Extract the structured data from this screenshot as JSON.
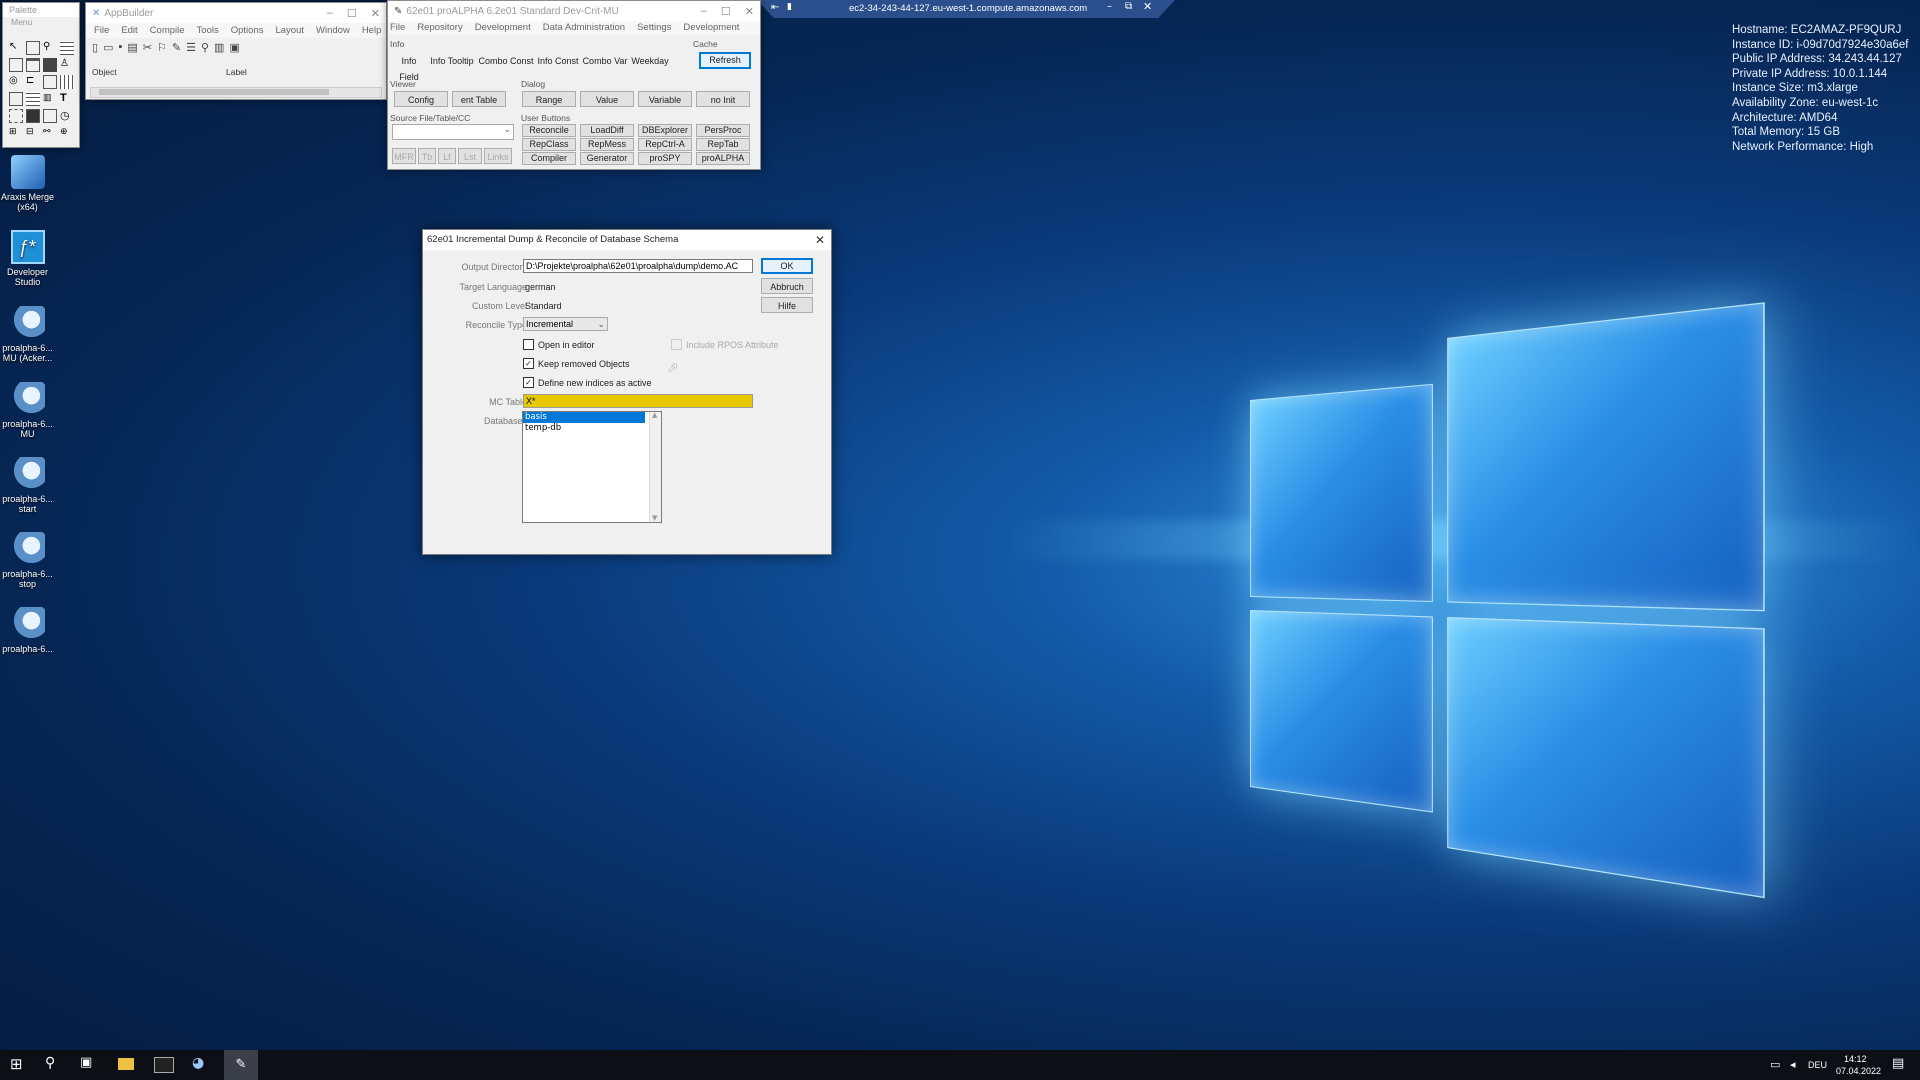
{
  "bginfo": [
    "Hostname: EC2AMAZ-PF9QURJ",
    "Instance ID: i-09d70d7924e30a6ef",
    "Public IP Address: 34.243.44.127",
    "Private IP Address: 10.0.1.144",
    "Instance Size: m3.xlarge",
    "Availability Zone: eu-west-1c",
    "Architecture: AMD64",
    "Total Memory: 15 GB",
    "Network Performance: High"
  ],
  "rdp_bar": {
    "title": "ec2-34-243-44-127.eu-west-1.compute.amazonaws.com"
  },
  "desktop_icons": [
    {
      "label": "Araxis Merge (x64)"
    },
    {
      "label": "Developer Studio"
    },
    {
      "label": "proalpha-6... MU (Acker..."
    },
    {
      "label": "proalpha-6... MU"
    },
    {
      "label": "proalpha-6... start"
    },
    {
      "label": "proalpha-6... stop"
    },
    {
      "label": "proalpha-6..."
    }
  ],
  "palette": {
    "title": "Palette",
    "menu": "Menu"
  },
  "appbuilder": {
    "title": "AppBuilder",
    "menu": [
      "File",
      "Edit",
      "Compile",
      "Tools",
      "Options",
      "Layout",
      "Window",
      "Help"
    ],
    "object_label": "Object",
    "label_label": "Label"
  },
  "proalpha": {
    "title": "62e01 proALPHA 6.2e01 Standard Dev-Crit-MU",
    "menu": [
      "File",
      "Repository",
      "Development",
      "Data Administration",
      "Settings",
      "Development"
    ],
    "info_group": "Info",
    "info_buttons": [
      "Info Field",
      "Info Tooltip",
      "Combo Const",
      "Info Const",
      "Combo Var",
      "Weekday"
    ],
    "cache_group": "Cache",
    "refresh": "Refresh",
    "viewer_group": "Viewer",
    "viewer_buttons": [
      "Config",
      "ent Table"
    ],
    "dialog_group": "Dialog",
    "dialog_buttons": [
      "Range",
      "Value",
      "Variable",
      "no Init"
    ],
    "source_group": "Source File/Table/CC",
    "source_buttons": [
      "MFR",
      "Tb",
      "Lf",
      "Lst",
      "Links"
    ],
    "user_group": "User Buttons",
    "user_buttons": [
      "Reconcile",
      "LoadDiff",
      "DBExplorer",
      "PersProc",
      "RepClass",
      "RepMess",
      "RepCtrl-A",
      "RepTab",
      "Compiler",
      "Generator",
      "proSPY",
      "proALPHA"
    ]
  },
  "dialog": {
    "title": "62e01 Incremental Dump & Reconcile of Database Schema",
    "output_dir_label": "Output Directory",
    "output_dir_value": "D:\\Projekte\\proalpha\\62e01\\proalpha\\dump\\demo.AC",
    "target_lang_label": "Target Language",
    "target_lang_value": "german",
    "custom_level_label": "Custom Level",
    "custom_level_value": "Standard",
    "reconcile_type_label": "Reconcile Type",
    "reconcile_type_value": "Incremental",
    "open_in_editor": "Open in editor",
    "include_rpos": "Include RPOS Attribute",
    "keep_removed": "Keep removed Objects",
    "define_indices": "Define new indices as active",
    "mc_table_label": "MC Table",
    "mc_table_value": "X*",
    "databases_label": "Databases",
    "databases": [
      "basis",
      "temp-db"
    ],
    "ok": "OK",
    "cancel": "Abbruch",
    "help": "Hilfe"
  },
  "tray": {
    "lang": "DEU",
    "time": "14:12",
    "date": "07.04.2022"
  },
  "colors": {
    "mc_table_bg": "#e8c800",
    "selection": "#0078d7"
  }
}
